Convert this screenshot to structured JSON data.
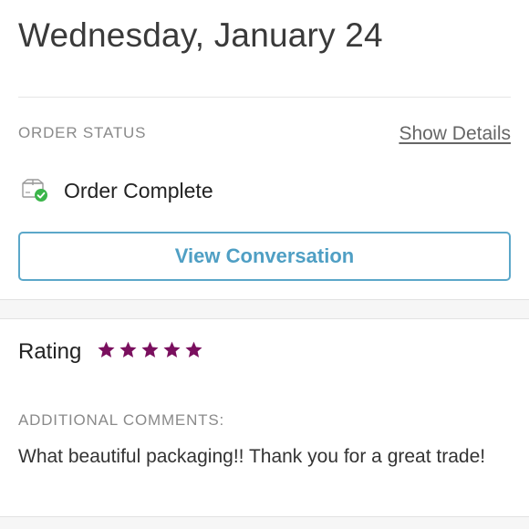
{
  "order": {
    "date": "Wednesday, January 24",
    "status_label": "ORDER STATUS",
    "show_details": "Show Details",
    "status_text": "Order Complete",
    "status_icon": "package-check-icon",
    "view_conversation": "View Conversation"
  },
  "review": {
    "rating_label": "Rating",
    "rating": 5,
    "max_rating": 5,
    "comments_label": "ADDITIONAL COMMENTS:",
    "comments": "What beautiful packaging!! Thank you for a great trade!"
  },
  "colors": {
    "accent_blue": "#4f9fc4",
    "star": "#7a0f5e",
    "status_green": "#3bb54a",
    "muted_text": "#8a8a8a"
  }
}
